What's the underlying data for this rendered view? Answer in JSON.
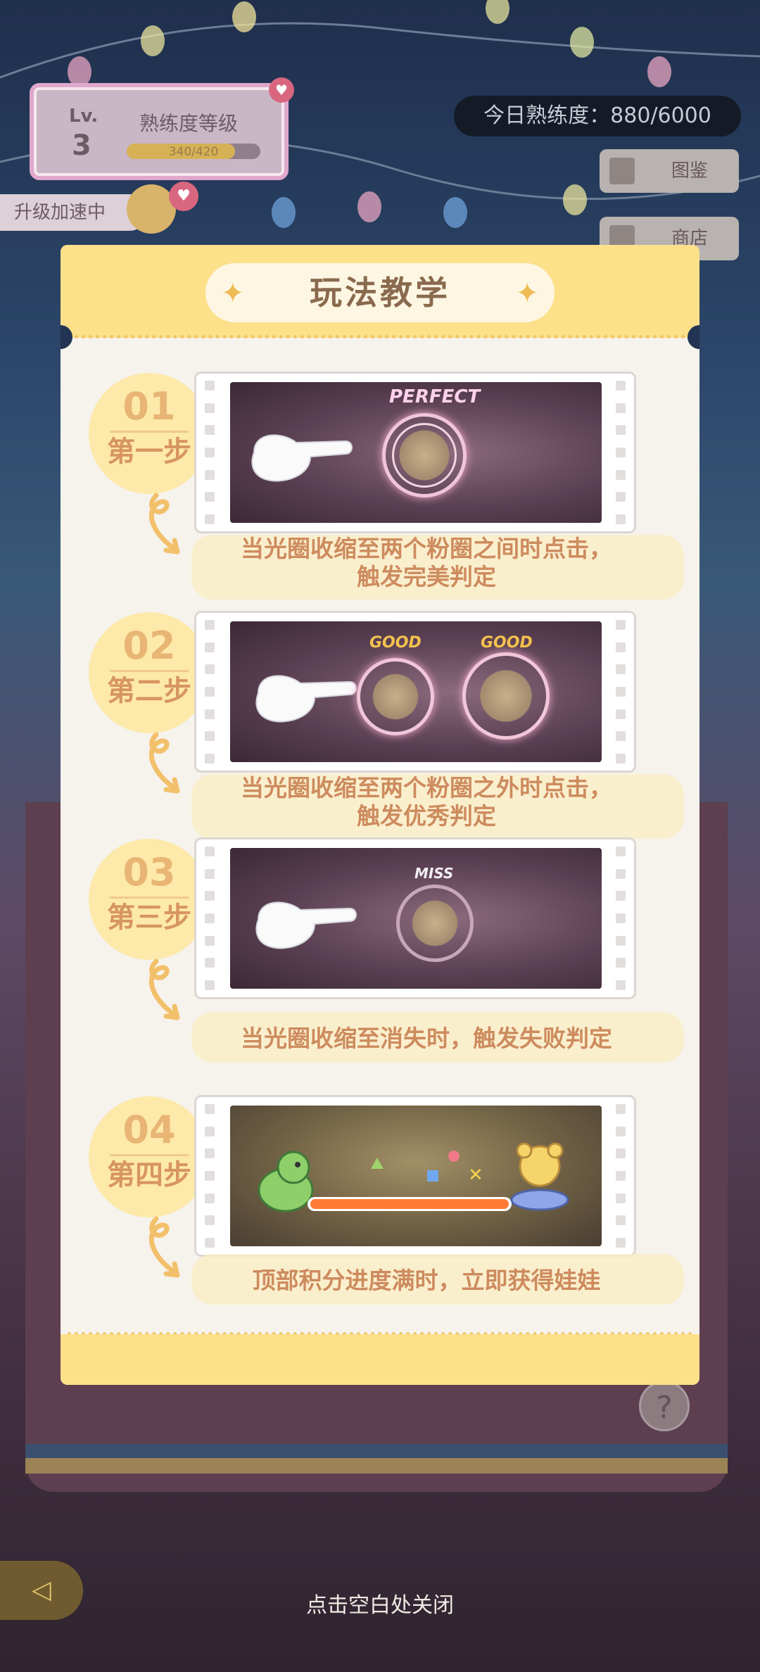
{
  "hud": {
    "level_label": "Lv.",
    "level_value": "3",
    "proficiency_title": "熟练度等级",
    "proficiency_progress_text": "340/420",
    "proficiency_progress_fraction": 0.81,
    "speedup_label": "升级加速中",
    "today_proficiency": "今日熟练度：880/6000",
    "side_buttons": [
      {
        "label": "图鉴",
        "icon": "book-icon"
      },
      {
        "label": "商店",
        "icon": "shop-icon"
      }
    ]
  },
  "modal": {
    "title": "玩法教学",
    "steps": [
      {
        "number": "01",
        "name": "第一步",
        "caption_line1": "当光圈收缩至两个粉圈之间时点击，",
        "caption_line2": "触发完美判定",
        "judge": [
          "PERFECT"
        ]
      },
      {
        "number": "02",
        "name": "第二步",
        "caption_line1": "当光圈收缩至两个粉圈之外时点击，",
        "caption_line2": "触发优秀判定",
        "judge": [
          "GOOD",
          "GOOD"
        ]
      },
      {
        "number": "03",
        "name": "第三步",
        "caption_line1": "当光圈收缩至消失时，触发失败判定",
        "caption_line2": "",
        "judge": [
          "MISS"
        ]
      },
      {
        "number": "04",
        "name": "第四步",
        "caption_line1": "顶部积分进度满时，立即获得娃娃",
        "caption_line2": "",
        "judge": []
      }
    ]
  },
  "footer": {
    "close_hint": "点击空白处关闭",
    "help_symbol": "?"
  },
  "colors": {
    "modal_bg": "#f6f2ec",
    "header_yellow": "#fce08a",
    "step_circle": "#fde9a9",
    "caption_text": "#cd8b5e",
    "title_text": "#8a6a4e"
  }
}
